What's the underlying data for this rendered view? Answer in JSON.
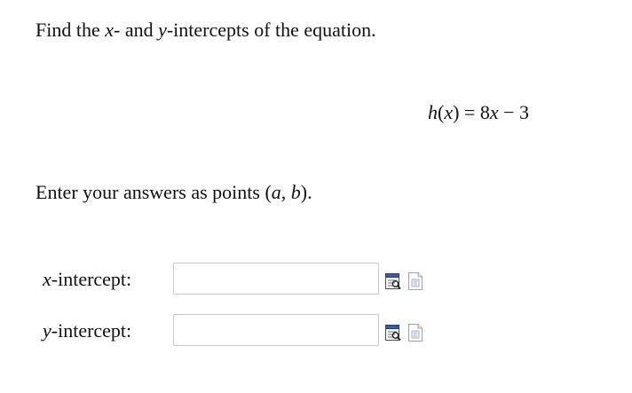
{
  "question": {
    "text_before": "Find the ",
    "var_x": "x",
    "text_middle": "- and ",
    "var_y": "y",
    "text_after": "-intercepts of the equation."
  },
  "equation": {
    "func": "h",
    "paren_open": "(",
    "arg": "x",
    "paren_close": ")",
    "equals": " = 8",
    "var": "x",
    "rest": " − 3"
  },
  "instruction": {
    "text": "Enter your answers as points ",
    "point_open": "(",
    "a": "a",
    "comma": ", ",
    "b": "b",
    "point_close": ")",
    "period": "."
  },
  "answers": [
    {
      "var": "x",
      "label_suffix": "-intercept:",
      "value": "",
      "placeholder": ""
    },
    {
      "var": "y",
      "label_suffix": "-intercept:",
      "value": "",
      "placeholder": ""
    }
  ],
  "icons": {
    "preview": "preview-icon",
    "help": "help-icon"
  }
}
